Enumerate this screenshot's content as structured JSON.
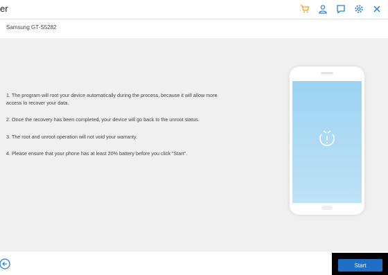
{
  "window": {
    "title": "er",
    "icons": [
      "cart-icon",
      "user-icon",
      "feedback-icon",
      "gear-icon",
      "close-icon"
    ],
    "accent_color": "#1f6fc7",
    "icon_color": "#2b7fd4",
    "cart_color": "#f0a020"
  },
  "device": {
    "name": "Samsung GT-S5282"
  },
  "instructions": [
    "1. The program will root your device automatically during the process, because it will allow more access to recover your data.",
    "2. Once the recovery has been completed, your device will go back to the unroot status.",
    "3. The root and unroot operation will not void your warranty.",
    "4. Please ensure that your phone has at least 20% battery before you click \"Start\"."
  ],
  "footer": {
    "start_label": "Start",
    "back_icon": "back-arrow-icon"
  }
}
